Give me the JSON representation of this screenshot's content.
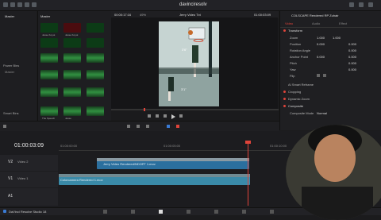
{
  "app": {
    "title": "davinciresolv"
  },
  "media_pool": {
    "title": "Master",
    "power_bins_label": "Power Bins",
    "smart_bins_label": "Smart Bins",
    "clip_names": [
      "Jesse Koyot",
      "Jesse Koyot",
      "Effective Clip",
      "Smart Bin",
      "Whole",
      "The Speech",
      "Jesse"
    ]
  },
  "viewer": {
    "zoom": "49%",
    "timecode_left": "00:00:17:16",
    "clip_title": "Jerry Video Txt",
    "timecode_right": "01:00:03:09",
    "overlay_text_top": "3'6\"",
    "overlay_text_bottom": "3'1\""
  },
  "inspector": {
    "clip_name": "COLSCAPE Rendered RP Zuhair",
    "tab_video": "Video",
    "tab_audio": "Audio",
    "tab_effect": "Effect",
    "section_transform": "Transform",
    "zoom_label": "Zoom",
    "zoom_x": "1.000",
    "zoom_y": "1.000",
    "position_label": "Position",
    "position_x": "0.000",
    "position_y": "0.000",
    "rotation_label": "Rotation Angle",
    "rotation_value": "0.000",
    "anchor_label": "Anchor Point",
    "anchor_x": "0.000",
    "anchor_y": "0.000",
    "pitch_label": "Pitch",
    "pitch_value": "0.000",
    "yaw_label": "Yaw",
    "yaw_value": "0.000",
    "flip_label": "Flip",
    "section_smart_reframe": "AI Smart Reframe",
    "section_cropping": "Cropping",
    "section_dynamic_zoom": "Dynamic Zoom",
    "section_composite": "Composite",
    "composite_mode_label": "Composite Mode",
    "composite_mode_value": "Normal"
  },
  "timeline": {
    "timecode": "01:00:03:09",
    "ruler_marks": [
      "01:00:00:00",
      "01:00:05:00",
      "01:00:10:00"
    ],
    "tracks": [
      {
        "id": "V2",
        "name": "Video 2"
      },
      {
        "id": "V1",
        "name": "Video 1"
      },
      {
        "id": "A1",
        "name": ""
      }
    ],
    "clip_v2": "Jerry Video Rendered/NDOFF 1.mov",
    "clip_v1": "Colorcamera Rendered 1.mov"
  },
  "status": {
    "app_name": "DaVinci Resolve Studio 18"
  },
  "colors": {
    "accent_red": "#e0443a",
    "clip_blue": "#2b6f9e",
    "clip_teal": "#3a8aa8",
    "wave_green": "#2f8a3e"
  }
}
